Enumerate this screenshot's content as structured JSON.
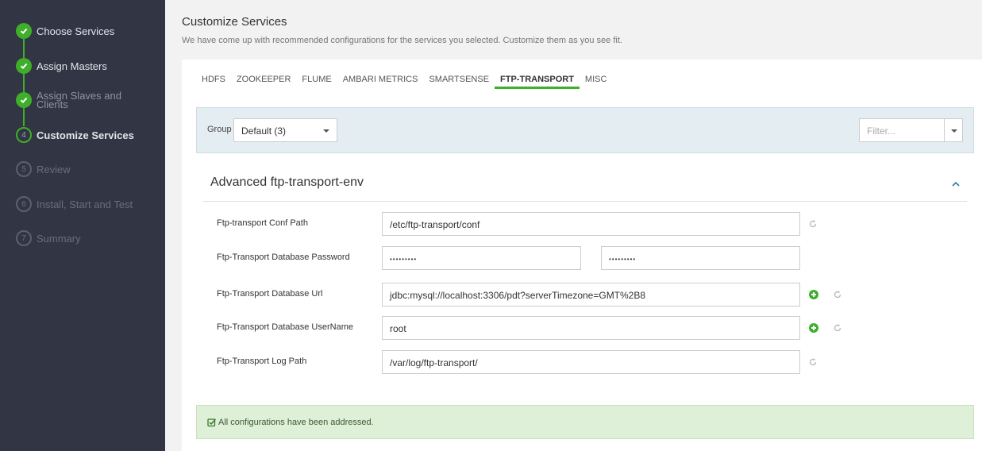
{
  "sidebar": {
    "steps": [
      {
        "number": "",
        "label": "Choose Services",
        "state": "done"
      },
      {
        "number": "",
        "label": "Assign Masters",
        "state": "done"
      },
      {
        "number": "",
        "label": "Assign Slaves and Clients",
        "state": "done"
      },
      {
        "number": "4",
        "label": "Customize Services",
        "state": "current"
      },
      {
        "number": "5",
        "label": "Review",
        "state": "pending"
      },
      {
        "number": "6",
        "label": "Install, Start and Test",
        "state": "pending"
      },
      {
        "number": "7",
        "label": "Summary",
        "state": "pending"
      }
    ]
  },
  "header": {
    "title": "Customize Services",
    "subtitle": "We have come up with recommended configurations for the services you selected. Customize them as you see fit."
  },
  "tabs": [
    "HDFS",
    "ZOOKEEPER",
    "FLUME",
    "AMBARI METRICS",
    "SMARTSENSE",
    "FTP-TRANSPORT",
    "MISC"
  ],
  "active_tab": "FTP-TRANSPORT",
  "filter_bar": {
    "group_label": "Group",
    "group_value": "Default (3)",
    "filter_placeholder": "Filter..."
  },
  "section": {
    "title": "Advanced ftp-transport-env",
    "rows": [
      {
        "label": "Ftp-transport Conf Path",
        "value": "/etc/ftp-transport/conf"
      },
      {
        "label": "Ftp-Transport Database Password",
        "value": "•••••••••",
        "confirm": "•••••••••"
      },
      {
        "label": "Ftp-Transport Database Url",
        "value": "jdbc:mysql://localhost:3306/pdt?serverTimezone=GMT%2B8"
      },
      {
        "label": "Ftp-Transport Database UserName",
        "value": "root"
      },
      {
        "label": "Ftp-Transport Log Path",
        "value": "/var/log/ftp-transport/"
      }
    ]
  },
  "alert": {
    "message": "All configurations have been addressed."
  },
  "colors": {
    "accent": "#3fae2a",
    "sidebar_bg": "#323544",
    "filter_bar_bg": "#e4edf2",
    "alert_bg": "#dff0d8"
  }
}
